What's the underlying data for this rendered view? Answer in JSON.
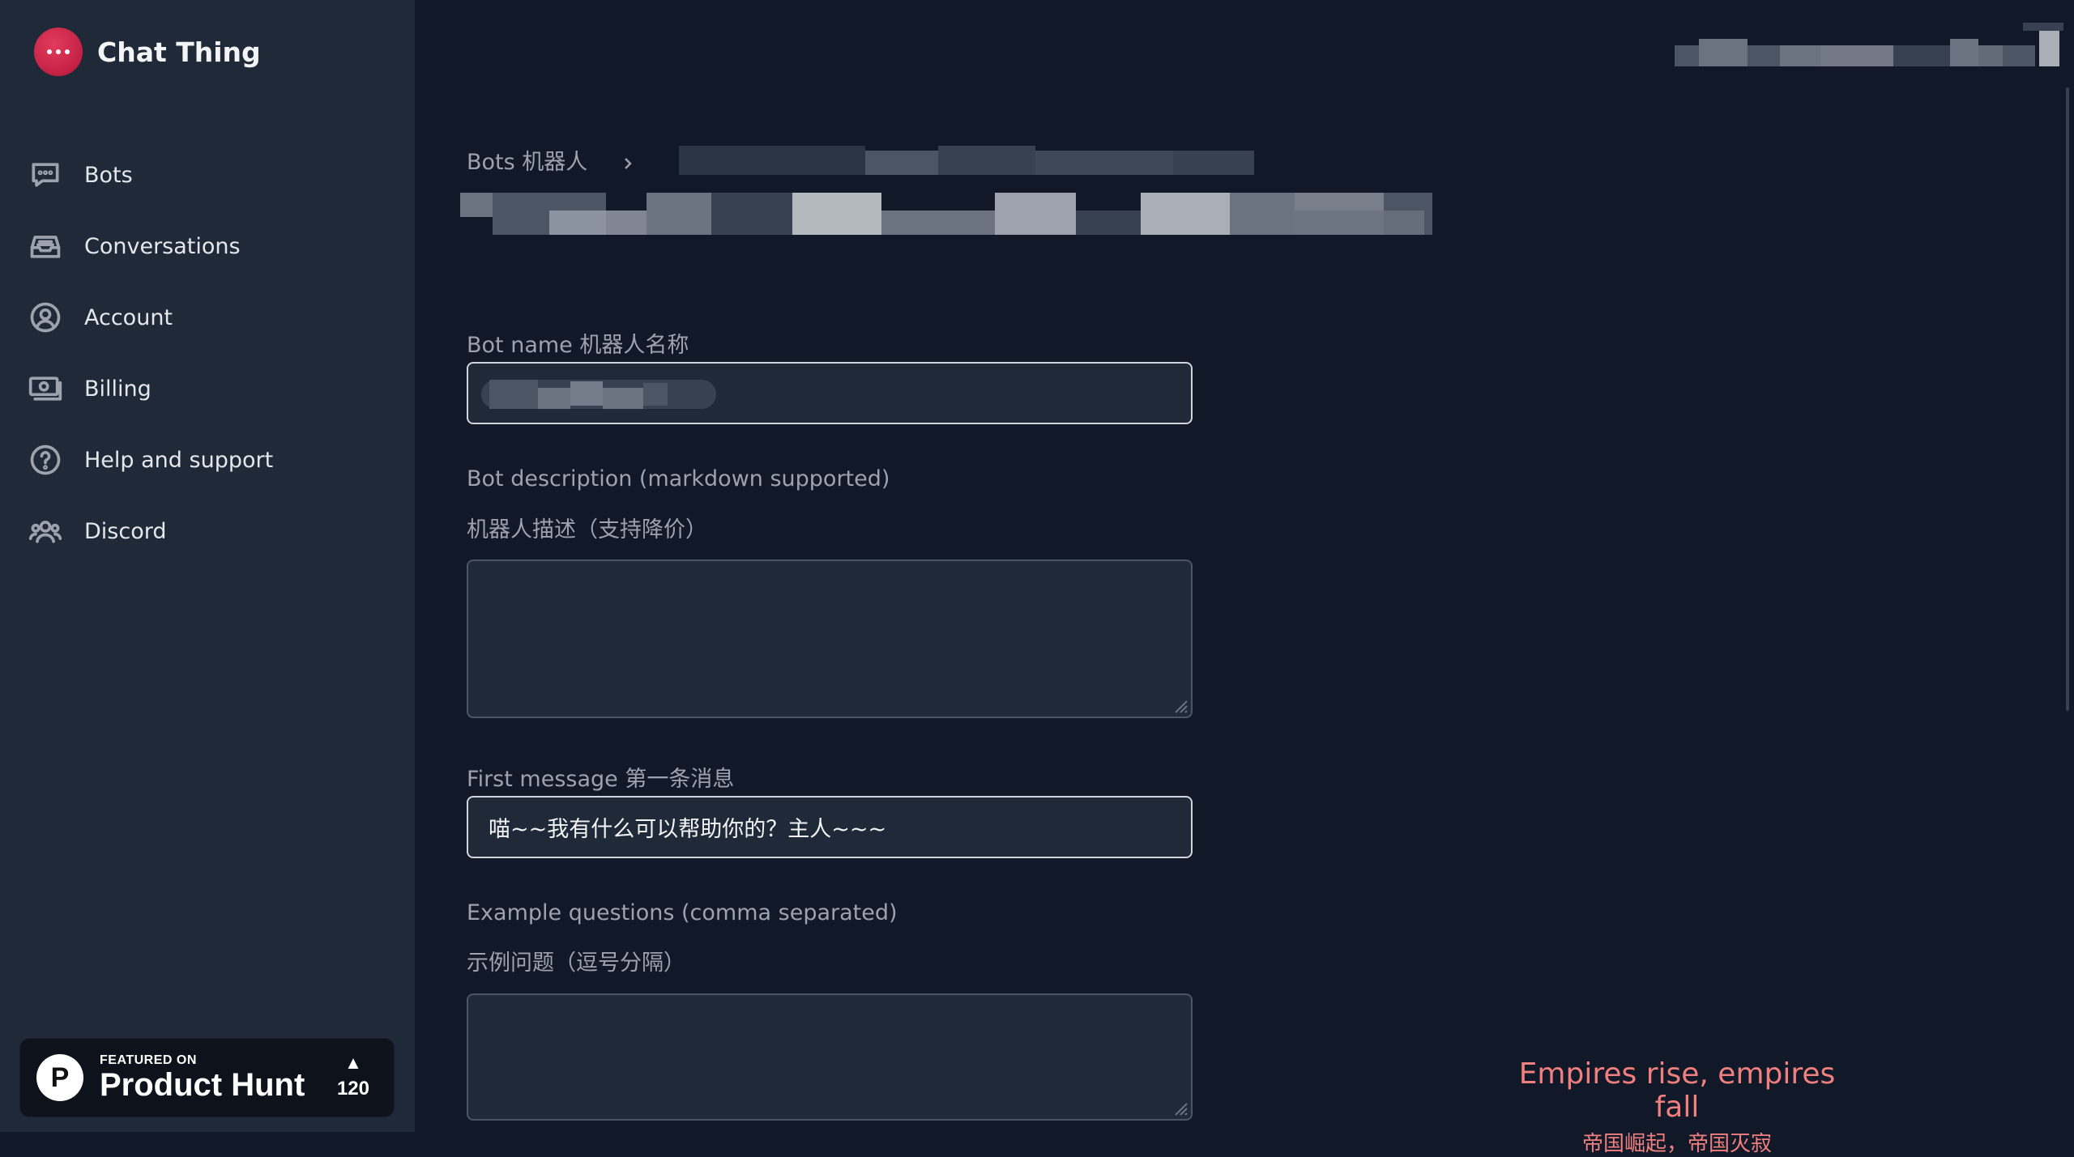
{
  "app": {
    "name": "Chat Thing",
    "logo_icon": "chat-bubble-icon",
    "accent": "#d11f4a"
  },
  "sidebar": {
    "items": [
      {
        "label": "Bots",
        "icon": "chat-icon"
      },
      {
        "label": "Conversations",
        "icon": "inbox-icon"
      },
      {
        "label": "Account",
        "icon": "user-circle-icon"
      },
      {
        "label": "Billing",
        "icon": "banknote-icon"
      },
      {
        "label": "Help and support",
        "icon": "question-circle-icon"
      },
      {
        "label": "Discord",
        "icon": "users-group-icon"
      }
    ],
    "product_hunt": {
      "featured": "FEATURED ON",
      "name": "Product Hunt",
      "logo": "P",
      "arrow": "▲",
      "votes": "120"
    }
  },
  "breadcrumb": {
    "root": "Bots 机器人"
  },
  "form": {
    "bot_name": {
      "label": "Bot name 机器人名称",
      "value": ""
    },
    "description": {
      "label": "Bot description (markdown supported)",
      "label_cn": "机器人描述（支持降价）",
      "value": ""
    },
    "first_message": {
      "label": "First message 第一条消息",
      "value": "喵~~我有什么可以帮助你的？主人~~~"
    },
    "example_questions": {
      "label": "Example questions (comma separated)",
      "label_cn": "示例问题（逗号分隔）",
      "value": ""
    }
  },
  "watermark": {
    "en": "Empires rise, empires fall",
    "cn": "帝国崛起，帝国灭寂"
  }
}
